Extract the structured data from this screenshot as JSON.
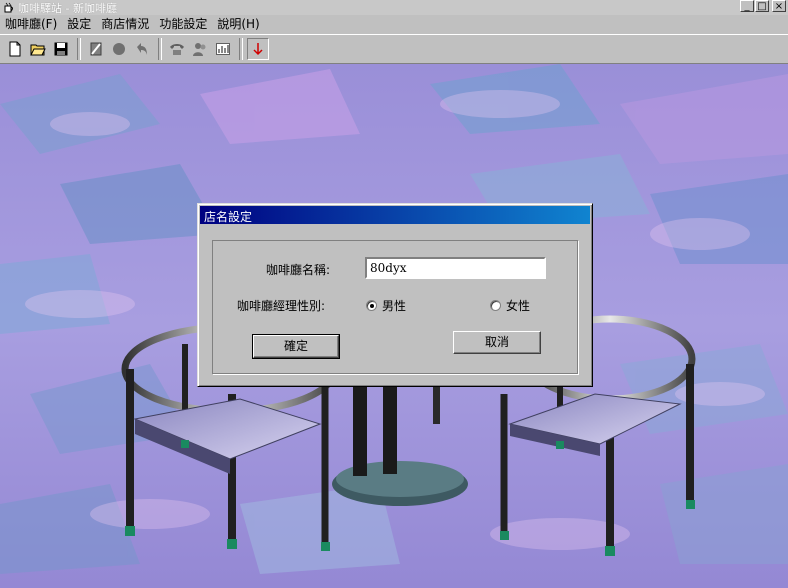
{
  "window": {
    "title": "咖啡驛站 - 新咖啡廳",
    "min_label": "_",
    "max_label": "□",
    "close_label": "×"
  },
  "menu": [
    "咖啡廳(F)",
    "設定",
    "商店情況",
    "功能設定",
    "說明(H)"
  ],
  "toolbar": {
    "icons": [
      "new-file-icon",
      "open-folder-icon",
      "save-icon",
      "tool-icon",
      "record-icon",
      "undo-icon",
      "phone-icon",
      "people-icon",
      "chart-icon",
      "down-arrow-icon"
    ]
  },
  "dialog": {
    "title": "店名設定",
    "name_label": "咖啡廳名稱:",
    "name_value": "80dyx",
    "gender_label": "咖啡廳經理性別:",
    "male_label": "男性",
    "female_label": "女性",
    "selected_gender": "male",
    "ok_label": "確定",
    "cancel_label": "取消"
  },
  "colors": {
    "dialog_title_start": "#000080",
    "dialog_title_end": "#1084d0",
    "background": "#9b90d8"
  }
}
